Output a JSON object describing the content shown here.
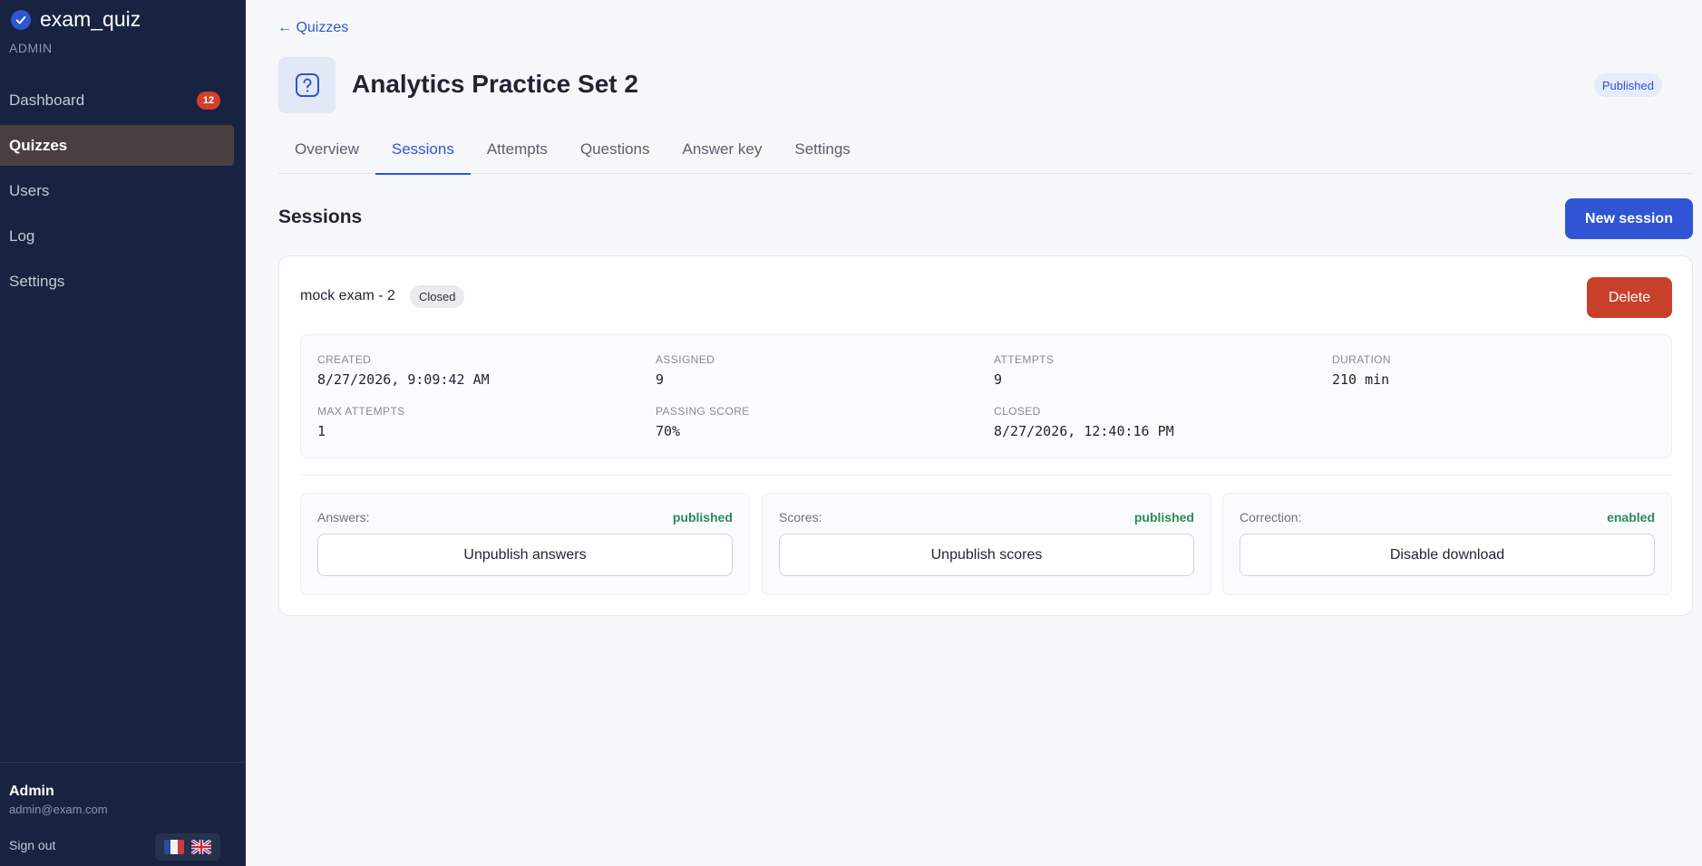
{
  "app": {
    "name": "exam_quiz",
    "role": "ADMIN"
  },
  "sidebar": {
    "items": [
      {
        "label": "Dashboard",
        "badge": "12"
      },
      {
        "label": "Quizzes"
      },
      {
        "label": "Users"
      },
      {
        "label": "Log"
      },
      {
        "label": "Settings"
      }
    ],
    "user": {
      "name": "Admin",
      "email": "admin@exam.com"
    },
    "signout": "Sign out"
  },
  "header": {
    "back_link": "← Quizzes",
    "title": "Analytics Practice Set 2",
    "status": "Published"
  },
  "tabs": [
    "Overview",
    "Sessions",
    "Attempts",
    "Questions",
    "Answer key",
    "Settings"
  ],
  "sessions": {
    "title": "Sessions",
    "new_button": "New session",
    "card": {
      "name": "mock exam - 2",
      "status": "Closed",
      "delete_button": "Delete",
      "info": {
        "created_label": "CREATED",
        "created": "8/27/2026, 9:09:42 AM",
        "assigned_label": "ASSIGNED",
        "assigned": "9",
        "attempts_label": "ATTEMPTS",
        "attempts": "9",
        "duration_label": "DURATION",
        "duration": "210 min",
        "max_attempts_label": "MAX ATTEMPTS",
        "max_attempts": "1",
        "passing_label": "PASSING SCORE",
        "passing": "70%",
        "closed_label": "CLOSED",
        "closed": "8/27/2026, 12:40:16 PM"
      },
      "actions": [
        {
          "label": "Answers:",
          "state": "published",
          "button": "Unpublish answers"
        },
        {
          "label": "Scores:",
          "state": "published",
          "button": "Unpublish scores"
        },
        {
          "label": "Correction:",
          "state": "enabled",
          "button": "Disable download"
        }
      ]
    }
  },
  "colors": {
    "accent": "#2f55d4",
    "danger": "#c9402a",
    "success": "#2a8a5c",
    "sidebar": "#172340"
  }
}
